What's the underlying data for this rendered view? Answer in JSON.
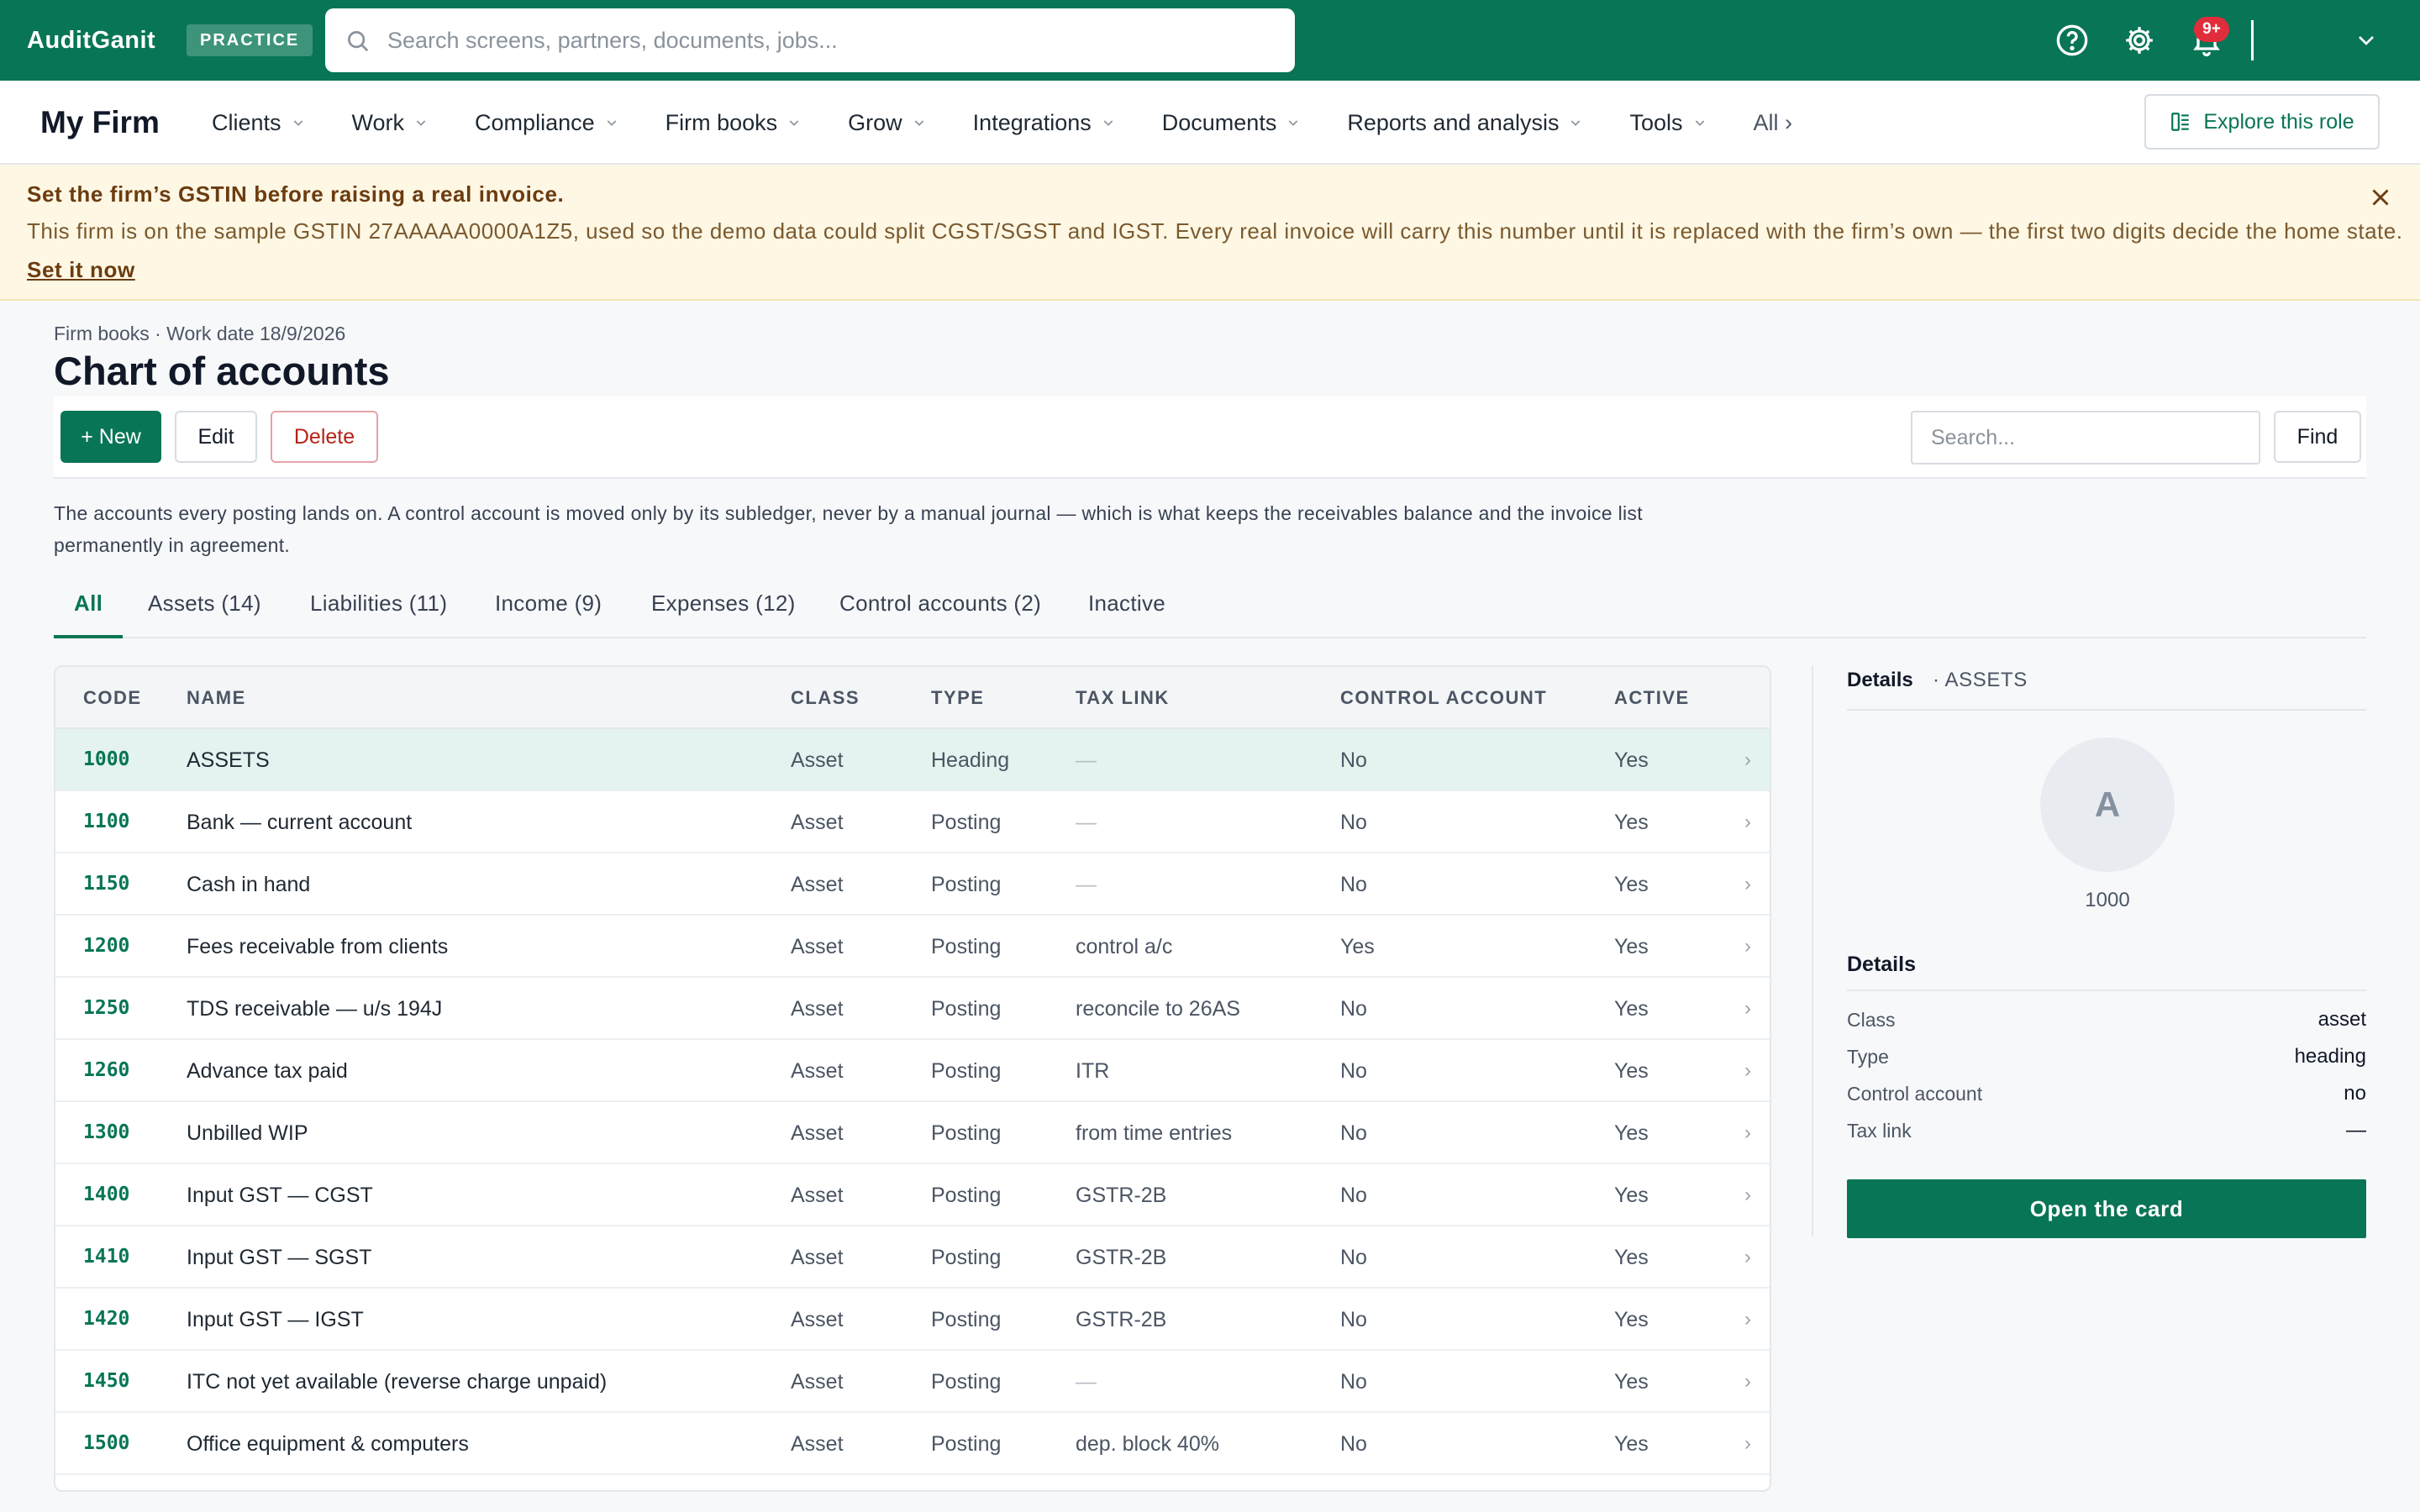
{
  "app": {
    "brand": "AuditGanit",
    "badge": "PRACTICE"
  },
  "search": {
    "placeholder": "Search screens, partners, documents, jobs..."
  },
  "notifications": {
    "count": "9+"
  },
  "nav": {
    "firm": "My Firm",
    "items": [
      "Clients",
      "Work",
      "Compliance",
      "Firm books",
      "Grow",
      "Integrations",
      "Documents",
      "Reports and analysis",
      "Tools"
    ],
    "all": "All ›",
    "explore": "Explore this role"
  },
  "banner": {
    "title": "Set the firm’s GSTIN before raising a real invoice.",
    "text": "This firm is on the sample GSTIN 27AAAAA0000A1Z5, used so the demo data could split CGST/SGST and IGST. Every real invoice will carry this number until it is replaced with the firm’s own — the first two digits decide the home state.",
    "link": "Set it now"
  },
  "page": {
    "breadcrumb": "Firm books · Work date 18/9/2026",
    "title": "Chart of accounts",
    "description": "The accounts every posting lands on. A control account is moved only by its subledger, never by a manual journal — which is what keeps the receivables balance and the invoice list permanently in agreement."
  },
  "toolbar": {
    "new": "+ New",
    "edit": "Edit",
    "delete": "Delete",
    "search_placeholder": "Search...",
    "find": "Find"
  },
  "tabs": [
    "All",
    "Assets (14)",
    "Liabilities (11)",
    "Income (9)",
    "Expenses (12)",
    "Control accounts (2)",
    "Inactive"
  ],
  "table": {
    "columns": [
      "CODE",
      "NAME",
      "CLASS",
      "TYPE",
      "TAX LINK",
      "CONTROL ACCOUNT",
      "ACTIVE"
    ],
    "rows": [
      {
        "code": "1000",
        "name": "ASSETS",
        "class": "Asset",
        "type": "Heading",
        "tax": "—",
        "control": "No",
        "active": "Yes"
      },
      {
        "code": "1100",
        "name": "Bank — current account",
        "class": "Asset",
        "type": "Posting",
        "tax": "—",
        "control": "No",
        "active": "Yes"
      },
      {
        "code": "1150",
        "name": "Cash in hand",
        "class": "Asset",
        "type": "Posting",
        "tax": "—",
        "control": "No",
        "active": "Yes"
      },
      {
        "code": "1200",
        "name": "Fees receivable from clients",
        "class": "Asset",
        "type": "Posting",
        "tax": "control a/c",
        "control": "Yes",
        "active": "Yes"
      },
      {
        "code": "1250",
        "name": "TDS receivable — u/s 194J",
        "class": "Asset",
        "type": "Posting",
        "tax": "reconcile to 26AS",
        "control": "No",
        "active": "Yes"
      },
      {
        "code": "1260",
        "name": "Advance tax paid",
        "class": "Asset",
        "type": "Posting",
        "tax": "ITR",
        "control": "No",
        "active": "Yes"
      },
      {
        "code": "1300",
        "name": "Unbilled WIP",
        "class": "Asset",
        "type": "Posting",
        "tax": "from time entries",
        "control": "No",
        "active": "Yes"
      },
      {
        "code": "1400",
        "name": "Input GST — CGST",
        "class": "Asset",
        "type": "Posting",
        "tax": "GSTR-2B",
        "control": "No",
        "active": "Yes"
      },
      {
        "code": "1410",
        "name": "Input GST — SGST",
        "class": "Asset",
        "type": "Posting",
        "tax": "GSTR-2B",
        "control": "No",
        "active": "Yes"
      },
      {
        "code": "1420",
        "name": "Input GST — IGST",
        "class": "Asset",
        "type": "Posting",
        "tax": "GSTR-2B",
        "control": "No",
        "active": "Yes"
      },
      {
        "code": "1450",
        "name": "ITC not yet available (reverse charge unpaid)",
        "class": "Asset",
        "type": "Posting",
        "tax": "—",
        "control": "No",
        "active": "Yes"
      },
      {
        "code": "1500",
        "name": "Office equipment & computers",
        "class": "Asset",
        "type": "Posting",
        "tax": "dep. block 40%",
        "control": "No",
        "active": "Yes"
      }
    ],
    "row_chevron": "›"
  },
  "details": {
    "heading": "Details",
    "subheading": "· ASSETS",
    "avatar_letter": "A",
    "code": "1000",
    "section": "Details",
    "fields": [
      {
        "label": "Class",
        "value": "asset"
      },
      {
        "label": "Type",
        "value": "heading"
      },
      {
        "label": "Control account",
        "value": "no"
      },
      {
        "label": "Tax link",
        "value": "—"
      }
    ],
    "open_button": "Open the card"
  },
  "colors": {
    "brand": "#087556",
    "banner_bg": "#fef7e4",
    "danger": "#b42318",
    "selected_row": "#e4f3ef"
  }
}
